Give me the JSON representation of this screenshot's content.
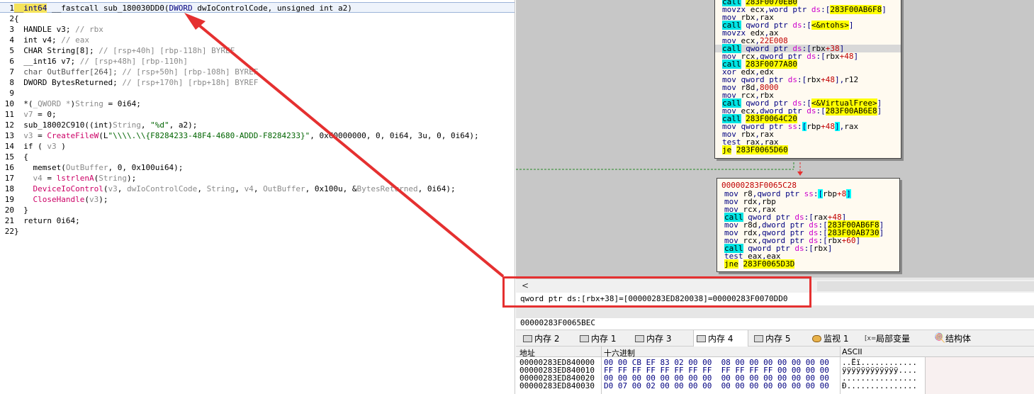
{
  "code": {
    "lines": [
      {
        "n": "1",
        "parts": [
          [
            "hl-int64 kw",
            "__int64"
          ],
          [
            "",
            " __fastcall sub_180030DD0("
          ],
          [
            "kw",
            "DWORD"
          ],
          [
            "",
            " dwIoControlCode, unsigned int a2)"
          ]
        ]
      },
      {
        "n": "2",
        "parts": [
          [
            "",
            "{"
          ]
        ]
      },
      {
        "n": "3",
        "parts": [
          [
            "",
            "  HANDLE v3; "
          ],
          [
            "gr",
            "// rbx"
          ]
        ]
      },
      {
        "n": "4",
        "parts": [
          [
            "",
            "  int v4; "
          ],
          [
            "gr",
            "// eax"
          ]
        ]
      },
      {
        "n": "5",
        "parts": [
          [
            "",
            "  CHAR String[8]; "
          ],
          [
            "gr",
            "// [rsp+40h] [rbp-118h] BYREF"
          ]
        ]
      },
      {
        "n": "6",
        "parts": [
          [
            "",
            "  __int16 v7; "
          ],
          [
            "gr",
            "// [rsp+48h] [rbp-110h]"
          ]
        ]
      },
      {
        "n": "7",
        "parts": [
          [
            "dgray",
            "  char OutBuffer[264]; "
          ],
          [
            "gr",
            "// [rsp+50h] [rbp-108h] BYREF"
          ]
        ]
      },
      {
        "n": "8",
        "parts": [
          [
            "",
            "  DWORD BytesReturned; "
          ],
          [
            "gr",
            "// [rsp+170h] [rbp+18h] BYREF"
          ]
        ]
      },
      {
        "n": "9",
        "parts": [
          [
            "",
            ""
          ]
        ]
      },
      {
        "n": "10",
        "parts": [
          [
            "",
            "  *("
          ],
          [
            "gr",
            "_QWORD *"
          ],
          [
            "",
            ")"
          ],
          [
            "gr",
            "String"
          ],
          [
            "",
            " = 0i64;"
          ]
        ]
      },
      {
        "n": "11",
        "parts": [
          [
            "gr",
            "  v7"
          ],
          [
            "",
            " = 0;"
          ]
        ]
      },
      {
        "n": "12",
        "parts": [
          [
            "",
            "  sub_18002C910((int)"
          ],
          [
            "gr",
            "String"
          ],
          [
            "",
            ", "
          ],
          [
            "str",
            "\"%d\""
          ],
          [
            "",
            ", a2);"
          ]
        ]
      },
      {
        "n": "13",
        "parts": [
          [
            "gr",
            "  v3"
          ],
          [
            "",
            " = "
          ],
          [
            "fn",
            "CreateFileW"
          ],
          [
            "",
            "(L"
          ],
          [
            "str",
            "\"\\\\\\\\.\\\\{F8284233-48F4-4680-ADDD-F8284233}\""
          ],
          [
            "",
            ", 0xC0000000, 0, 0i64, 3u, 0, 0i64);"
          ]
        ]
      },
      {
        "n": "14",
        "parts": [
          [
            "",
            "  if ( "
          ],
          [
            "gr",
            "v3"
          ],
          [
            "",
            " )"
          ]
        ]
      },
      {
        "n": "15",
        "parts": [
          [
            "",
            "  {"
          ]
        ]
      },
      {
        "n": "16",
        "parts": [
          [
            "",
            "    memset("
          ],
          [
            "gr",
            "OutBuffer"
          ],
          [
            "",
            ", 0, 0x100ui64);"
          ]
        ]
      },
      {
        "n": "17",
        "parts": [
          [
            "gr",
            "    v4"
          ],
          [
            "",
            " = "
          ],
          [
            "fn",
            "lstrlenA"
          ],
          [
            "",
            "("
          ],
          [
            "gr",
            "String"
          ],
          [
            "",
            ");"
          ]
        ]
      },
      {
        "n": "18",
        "parts": [
          [
            "fn",
            "    DeviceIoControl"
          ],
          [
            "",
            "("
          ],
          [
            "gr",
            "v3"
          ],
          [
            "",
            ", "
          ],
          [
            "gr",
            "dwIoControlCode"
          ],
          [
            "",
            ", "
          ],
          [
            "gr",
            "String"
          ],
          [
            "",
            ", "
          ],
          [
            "gr",
            "v4"
          ],
          [
            "",
            ", "
          ],
          [
            "gr",
            "OutBuffer"
          ],
          [
            "",
            ", 0x100u, &"
          ],
          [
            "gr",
            "BytesReturned"
          ],
          [
            "",
            ", 0i64);"
          ]
        ]
      },
      {
        "n": "19",
        "parts": [
          [
            "fn",
            "    CloseHandle"
          ],
          [
            "",
            "("
          ],
          [
            "gr",
            "v3"
          ],
          [
            "",
            ");"
          ]
        ]
      },
      {
        "n": "20",
        "parts": [
          [
            "",
            "  }"
          ]
        ]
      },
      {
        "n": "21",
        "parts": [
          [
            "",
            "  return 0i64;"
          ]
        ]
      },
      {
        "n": "22",
        "parts": [
          [
            "",
            "}"
          ]
        ]
      }
    ]
  },
  "graph": {
    "block1": [
      [
        [
          "call",
          "call"
        ],
        [
          "",
          " "
        ],
        [
          "addr-y",
          "283F0070EB0"
        ]
      ],
      [
        [
          "",
          "movzx "
        ],
        [
          "reg",
          "ecx"
        ],
        [
          "",
          ",word ptr "
        ],
        [
          "seg",
          "ds"
        ],
        [
          "",
          ":["
        ],
        [
          "addr-y",
          "283F00AB6F8"
        ],
        [
          "",
          "]"
        ]
      ],
      [
        [
          "",
          "mov "
        ],
        [
          "reg",
          "rbx"
        ],
        [
          "",
          ","
        ],
        [
          "reg",
          "rax"
        ]
      ],
      [
        [
          "call",
          "call"
        ],
        [
          "",
          " qword ptr "
        ],
        [
          "seg",
          "ds"
        ],
        [
          "",
          ":["
        ],
        [
          "addr-y",
          "<&ntohs>"
        ],
        [
          "",
          "]"
        ]
      ],
      [
        [
          "",
          "movzx "
        ],
        [
          "reg",
          "edx"
        ],
        [
          "",
          ","
        ],
        [
          "reg",
          "ax"
        ]
      ],
      [
        [
          "",
          "mov "
        ],
        [
          "reg",
          "ecx"
        ],
        [
          "",
          ","
        ],
        [
          "off",
          "22E008"
        ]
      ],
      [
        [
          "call",
          "call"
        ],
        [
          "",
          " qword ptr "
        ],
        [
          "seg",
          "ds"
        ],
        [
          "",
          ":["
        ],
        [
          "reg",
          "rbx"
        ],
        [
          "off",
          "+38"
        ],
        [
          "",
          "]"
        ]
      ],
      [
        [
          "",
          "mov "
        ],
        [
          "reg",
          "rcx"
        ],
        [
          "",
          ",qword ptr "
        ],
        [
          "seg",
          "ds"
        ],
        [
          "",
          ":["
        ],
        [
          "reg",
          "rbx"
        ],
        [
          "off",
          "+48"
        ],
        [
          "",
          "]"
        ]
      ],
      [
        [
          "call",
          "call"
        ],
        [
          "",
          " "
        ],
        [
          "addr-y",
          "283F0077A80"
        ]
      ],
      [
        [
          "",
          "xor "
        ],
        [
          "reg",
          "edx"
        ],
        [
          "",
          ","
        ],
        [
          "reg",
          "edx"
        ]
      ],
      [
        [
          "",
          "mov qword ptr "
        ],
        [
          "seg",
          "ds"
        ],
        [
          "",
          ":["
        ],
        [
          "reg",
          "rbx"
        ],
        [
          "off",
          "+48"
        ],
        [
          "",
          "],"
        ],
        [
          "reg",
          "r12"
        ]
      ],
      [
        [
          "",
          "mov "
        ],
        [
          "reg",
          "r8d"
        ],
        [
          "",
          ","
        ],
        [
          "off",
          "8000"
        ]
      ],
      [
        [
          "",
          "mov "
        ],
        [
          "reg",
          "rcx"
        ],
        [
          "",
          ","
        ],
        [
          "reg",
          "rbx"
        ]
      ],
      [
        [
          "call",
          "call"
        ],
        [
          "",
          " qword ptr "
        ],
        [
          "seg",
          "ds"
        ],
        [
          "",
          ":["
        ],
        [
          "addr-y",
          "<&VirtualFree>"
        ],
        [
          "",
          "]"
        ]
      ],
      [
        [
          "",
          "mov "
        ],
        [
          "reg",
          "ecx"
        ],
        [
          "",
          ",dword ptr "
        ],
        [
          "seg",
          "ds"
        ],
        [
          "",
          ":["
        ],
        [
          "addr-y",
          "283F00AB6E8"
        ],
        [
          "",
          "]"
        ]
      ],
      [
        [
          "call",
          "call"
        ],
        [
          "",
          " "
        ],
        [
          "addr-y",
          "283F0064C20"
        ]
      ],
      [
        [
          "",
          "mov qword ptr "
        ],
        [
          "seg",
          "ss"
        ],
        [
          "",
          ":"
        ],
        [
          "bkt",
          "["
        ],
        [
          "reg",
          "rbp"
        ],
        [
          "off",
          "+48"
        ],
        [
          "bkt",
          "]"
        ],
        [
          "",
          ","
        ],
        [
          "reg",
          "rax"
        ]
      ],
      [
        [
          "",
          "mov "
        ],
        [
          "reg",
          "rbx"
        ],
        [
          "",
          ","
        ],
        [
          "reg",
          "rax"
        ]
      ],
      [
        [
          "",
          "test "
        ],
        [
          "reg",
          "rax"
        ],
        [
          "",
          ","
        ],
        [
          "reg",
          "rax"
        ]
      ],
      [
        [
          "jmp-y",
          "je"
        ],
        [
          "",
          " "
        ],
        [
          "addr-y",
          "283F0065D60"
        ]
      ]
    ],
    "block2_title": "00000283F0065C28",
    "block2": [
      [
        [
          "",
          "mov "
        ],
        [
          "reg",
          "r8"
        ],
        [
          "",
          ",qword ptr "
        ],
        [
          "seg",
          "ss"
        ],
        [
          "",
          ":"
        ],
        [
          "bkt",
          "["
        ],
        [
          "reg",
          "rbp"
        ],
        [
          "off",
          "+8"
        ],
        [
          "bkt",
          "]"
        ]
      ],
      [
        [
          "",
          "mov "
        ],
        [
          "reg",
          "rdx"
        ],
        [
          "",
          ","
        ],
        [
          "reg",
          "rbp"
        ]
      ],
      [
        [
          "",
          "mov "
        ],
        [
          "reg",
          "rcx"
        ],
        [
          "",
          ","
        ],
        [
          "reg",
          "rax"
        ]
      ],
      [
        [
          "call",
          "call"
        ],
        [
          "",
          " qword ptr "
        ],
        [
          "seg",
          "ds"
        ],
        [
          "",
          ":["
        ],
        [
          "reg",
          "rax"
        ],
        [
          "off",
          "+48"
        ],
        [
          "",
          "]"
        ]
      ],
      [
        [
          "",
          "mov "
        ],
        [
          "reg",
          "r8d"
        ],
        [
          "",
          ",dword ptr "
        ],
        [
          "seg",
          "ds"
        ],
        [
          "",
          ":["
        ],
        [
          "addr-y",
          "283F00AB6F8"
        ],
        [
          "",
          "]"
        ]
      ],
      [
        [
          "",
          "mov "
        ],
        [
          "reg",
          "rdx"
        ],
        [
          "",
          ",qword ptr "
        ],
        [
          "seg",
          "ds"
        ],
        [
          "",
          ":["
        ],
        [
          "addr-y",
          "283F00AB730"
        ],
        [
          "",
          "]"
        ]
      ],
      [
        [
          "",
          "mov "
        ],
        [
          "reg",
          "rcx"
        ],
        [
          "",
          ",qword ptr "
        ],
        [
          "seg",
          "ds"
        ],
        [
          "",
          ":["
        ],
        [
          "reg",
          "rbx"
        ],
        [
          "off",
          "+60"
        ],
        [
          "",
          "]"
        ]
      ],
      [
        [
          "call",
          "call"
        ],
        [
          "",
          " qword ptr "
        ],
        [
          "seg",
          "ds"
        ],
        [
          "",
          ":["
        ],
        [
          "reg",
          "rbx"
        ],
        [
          "",
          "]"
        ]
      ],
      [
        [
          "",
          "test "
        ],
        [
          "reg",
          "eax"
        ],
        [
          "",
          ","
        ],
        [
          "reg",
          "eax"
        ]
      ],
      [
        [
          "jmp-y",
          "jne"
        ],
        [
          "",
          " "
        ],
        [
          "addr-y",
          "283F0065D3D"
        ]
      ]
    ]
  },
  "scroll_left": "<",
  "info_line": "qword ptr ds:[rbx+38]=[00000283ED820038]=00000283F0070DD0",
  "addr_line": "00000283F0065BEC",
  "tabs": [
    {
      "label": "内存 2",
      "icon": "memory-icon"
    },
    {
      "label": "内存 1",
      "icon": "memory-icon"
    },
    {
      "label": "内存 3",
      "icon": "memory-icon"
    },
    {
      "label": "内存 4",
      "icon": "memory-icon"
    },
    {
      "label": "内存 5",
      "icon": "memory-icon"
    },
    {
      "label": "监视 1",
      "icon": "watch-icon"
    },
    {
      "label": "局部变量",
      "icon": "locals-icon",
      "glyph": "[x=]"
    },
    {
      "label": "结构体",
      "icon": "struct-icon",
      "glyph": "🍭"
    }
  ],
  "dump": {
    "headers": {
      "addr": "地址",
      "hex": "十六进制",
      "ascii": "ASCII"
    },
    "rows": [
      {
        "addr": "00000283ED840000",
        "hex": "00 00 CB EF 83 02 00 00  08 00 00 00 00 00 00 00",
        "ascii": "..Ëï............"
      },
      {
        "addr": "00000283ED840010",
        "hex": "FF FF FF FF FF FF FF FF  FF FF FF FF 00 00 00 00",
        "ascii": "ÿÿÿÿÿÿÿÿÿÿÿÿ...."
      },
      {
        "addr": "00000283ED840020",
        "hex": "00 00 00 00 00 00 00 00  00 00 00 00 00 00 00 00",
        "ascii": "................"
      },
      {
        "addr": "00000283ED840030",
        "hex": "D0 07 00 02 00 00 00 00  00 00 00 00 00 00 00 00",
        "ascii": "Ð..............."
      }
    ]
  },
  "colors": {
    "annotation": "#e53030",
    "graph_bg": "#c7c7c7"
  }
}
